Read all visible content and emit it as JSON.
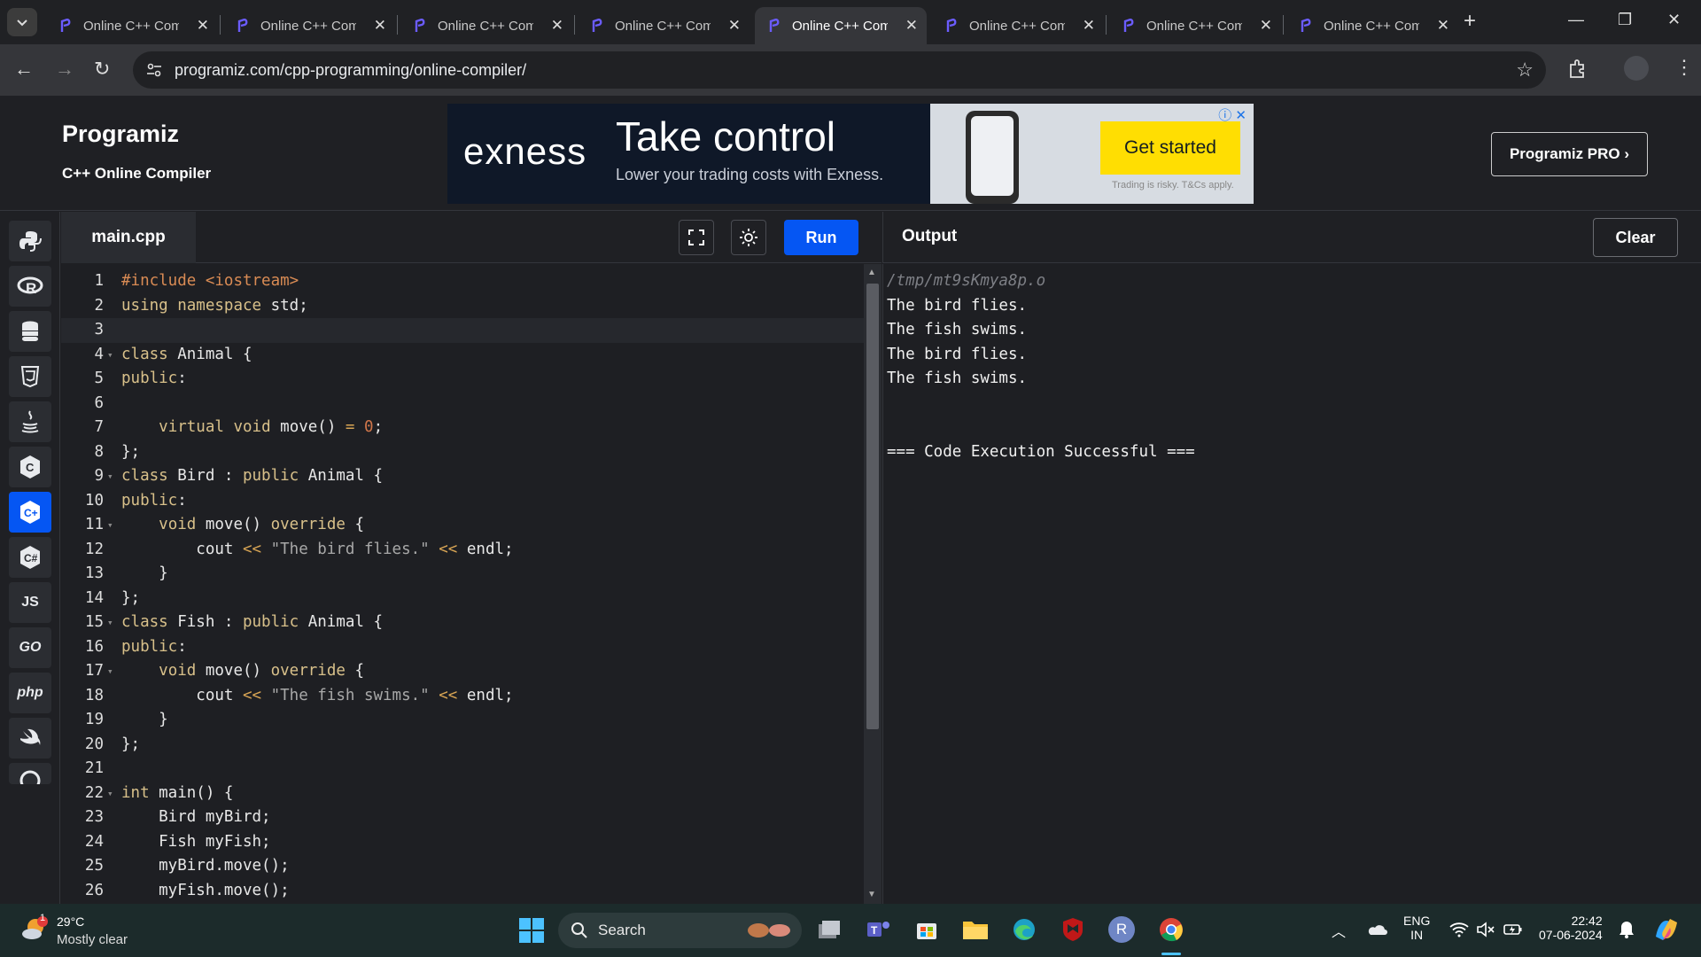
{
  "browser": {
    "tabs": [
      {
        "title": "Online C++ Compiler",
        "active": false
      },
      {
        "title": "Online C++ Compiler",
        "active": false
      },
      {
        "title": "Online C++ Compiler",
        "active": false
      },
      {
        "title": "Online C++ Compiler",
        "active": false
      },
      {
        "title": "Online C++ Compiler",
        "active": true
      },
      {
        "title": "Online C++ Compiler",
        "active": false
      },
      {
        "title": "Online C++ Compiler",
        "active": false
      },
      {
        "title": "Online C++ Compiler",
        "active": false
      }
    ],
    "url": "programiz.com/cpp-programming/online-compiler/"
  },
  "header": {
    "logo": "Programiz",
    "subtitle": "C++ Online Compiler",
    "pro_button": "Programiz PRO ›"
  },
  "ad": {
    "brand": "exness",
    "headline": "Take control",
    "subline": "Lower your trading costs with Exness.",
    "cta": "Get started",
    "disclaimer": "Trading is risky. T&Cs apply."
  },
  "sidebar": {
    "languages": [
      "python",
      "r",
      "sql",
      "html",
      "java",
      "c",
      "cpp",
      "csharp",
      "js",
      "go",
      "php",
      "swift",
      "rust"
    ],
    "labels": {
      "js": "JS",
      "go": "GO",
      "php": "php"
    },
    "selected": "cpp"
  },
  "editor": {
    "filename": "main.cpp",
    "run_label": "Run",
    "lines": [
      "#include <iostream>",
      "using namespace std;",
      "",
      "class Animal {",
      "public:",
      "",
      "    virtual void move() = 0;",
      "};",
      "class Bird : public Animal {",
      "public:",
      "    void move() override {",
      "        cout << \"The bird flies.\" << endl;",
      "    }",
      "};",
      "class Fish : public Animal {",
      "public:",
      "    void move() override {",
      "        cout << \"The fish swims.\" << endl;",
      "    }",
      "};",
      "",
      "int main() {",
      "    Bird myBird;",
      "    Fish myFish;",
      "    myBird.move();",
      "    myFish.move();"
    ],
    "fold_lines": [
      4,
      9,
      11,
      15,
      17,
      22
    ],
    "current_line": 3
  },
  "output": {
    "title": "Output",
    "clear_label": "Clear",
    "lines": [
      "/tmp/mt9sKmya8p.o",
      "The bird flies.",
      "The fish swims.",
      "The bird flies.",
      "The fish swims.",
      "",
      "",
      "=== Code Execution Successful ==="
    ]
  },
  "taskbar": {
    "temperature": "29°C",
    "weather": "Mostly clear",
    "weather_badge": "1",
    "search_label": "Search",
    "lang_top": "ENG",
    "lang_bottom": "IN",
    "time": "22:42",
    "date": "07-06-2024"
  },
  "colors": {
    "accent": "#0556f3",
    "ad_cta": "#ffde02",
    "background": "#1e1f23"
  }
}
